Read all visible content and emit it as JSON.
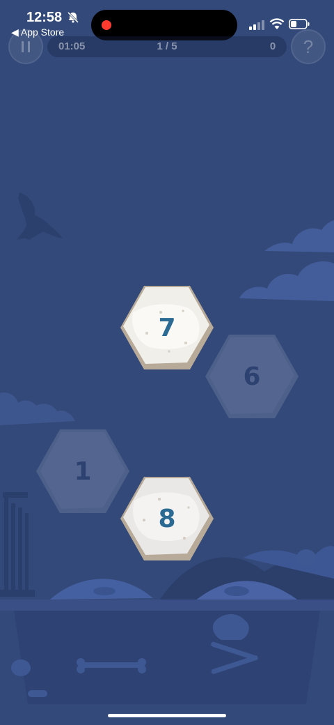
{
  "status_bar": {
    "time": "12:58",
    "back_label": "◀ App Store",
    "icons": [
      "bell-slash-icon",
      "recording-dot-icon",
      "signal-icon",
      "wifi-icon",
      "battery-icon"
    ]
  },
  "hud": {
    "timer": "01:05",
    "progress": "1 / 5",
    "score": "0",
    "help_label": "?",
    "icons": [
      "pause-icon"
    ]
  },
  "tiles": {
    "seven": "7",
    "six": "6",
    "one": "1",
    "eight": "8"
  },
  "colors": {
    "background": "#334979",
    "tile_stone": "#f1efea",
    "tile_edge": "#b8aa98",
    "number_active": "#2a6a93"
  }
}
